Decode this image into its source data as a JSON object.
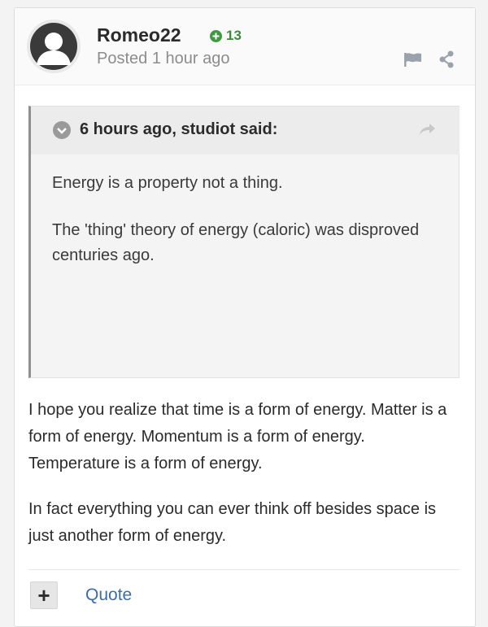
{
  "post": {
    "author": "Romeo22",
    "reputation": "13",
    "posted": "Posted 1 hour ago",
    "actions": {
      "flag_icon": "flag-icon",
      "share_icon": "share-icon"
    }
  },
  "quote": {
    "cite": "6 hours ago, studiot said:",
    "paragraphs": [
      "Energy is a property not a thing.",
      "The 'thing' theory of energy (caloric) was disproved centuries ago."
    ]
  },
  "body": {
    "paragraphs": [
      "I hope you realize that time is a form of energy. Matter is a form of energy. Momentum is a form of energy. Temperature is a form of energy.",
      "In fact everything you can ever think off besides space is just another form of energy."
    ]
  },
  "footer": {
    "plus_label": "+",
    "quote_label": "Quote"
  },
  "colors": {
    "reputation": "#3a8c3a",
    "link": "#3d6ca8",
    "quote_border": "#8f8f8f"
  }
}
